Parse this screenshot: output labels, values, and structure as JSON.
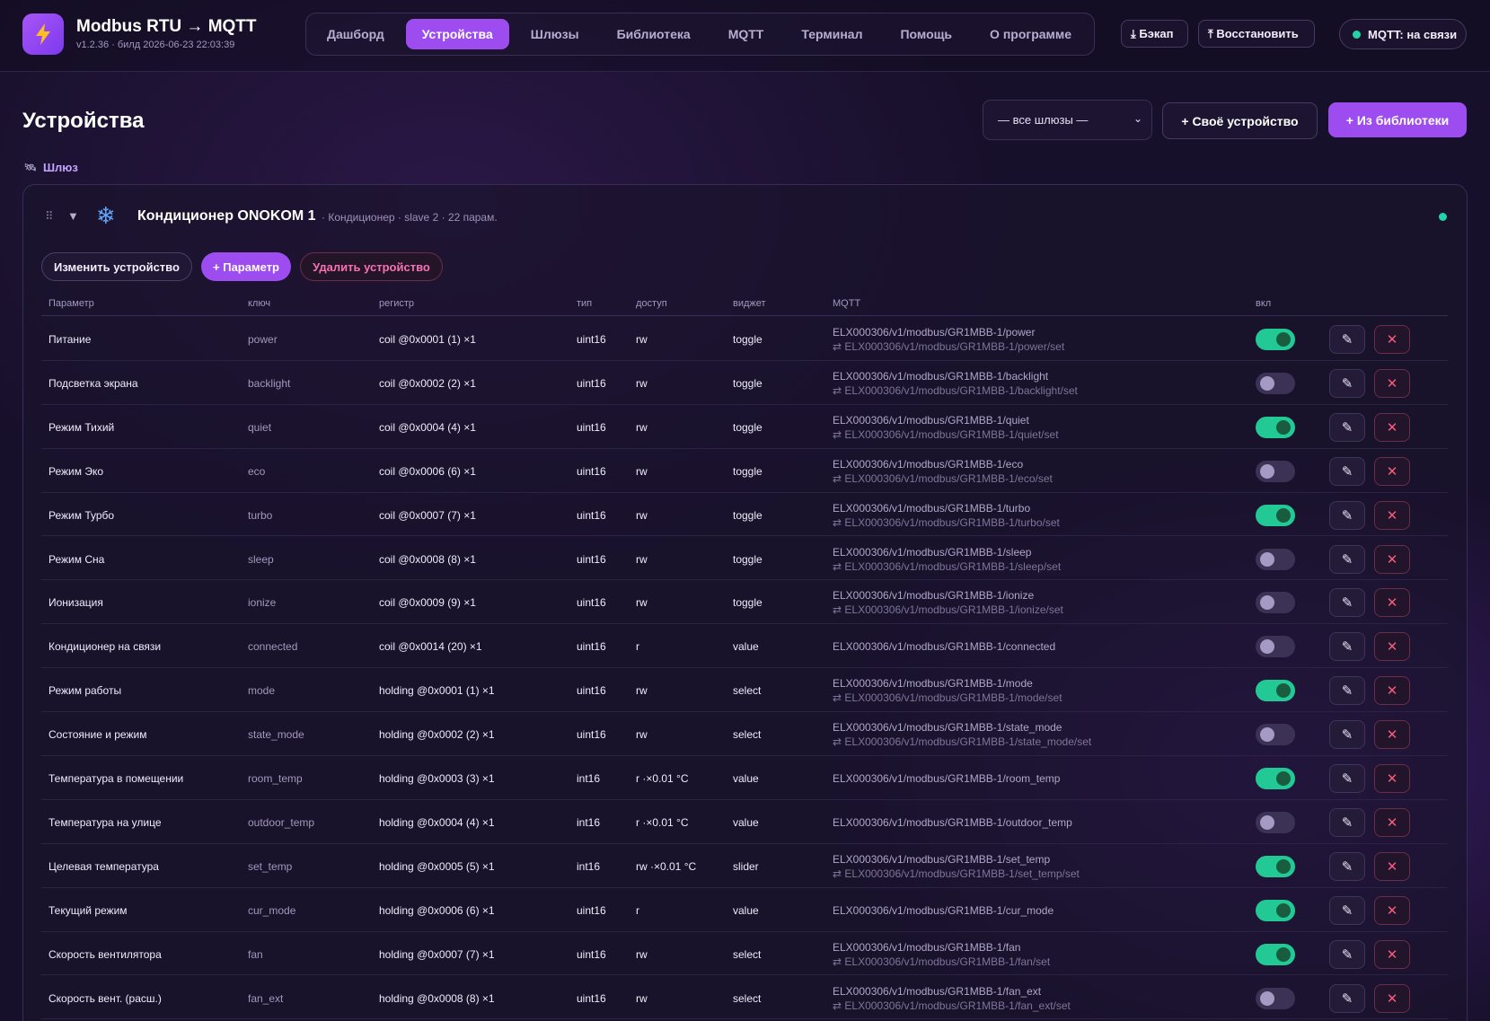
{
  "app": {
    "title": "Modbus RTU → MQTT",
    "subtitle": "v1.2.36 · билд 2026-06-23 22:03:39"
  },
  "nav": {
    "tabs": [
      {
        "label": "Дашборд",
        "active": false
      },
      {
        "label": "Устройства",
        "active": true
      },
      {
        "label": "Шлюзы",
        "active": false
      },
      {
        "label": "Библиотека",
        "active": false
      },
      {
        "label": "MQTT",
        "active": false
      },
      {
        "label": "Терминал",
        "active": false
      },
      {
        "label": "Помощь",
        "active": false
      },
      {
        "label": "О программе",
        "active": false
      }
    ]
  },
  "header_actions": {
    "backup_label": "⤓ Бэкап",
    "restore_label": "⤒ Восстановить",
    "mqtt_status": "MQTT: на связи"
  },
  "page": {
    "title": "Устройства",
    "gateway_filter": "— все шлюзы —",
    "add_custom_label": "+ Своё устройство",
    "add_from_library_label": "+ Из библиотеки",
    "gateway_group_label": "Шлюз"
  },
  "device": {
    "name": "Кондиционер ONOKOM 1",
    "meta": "· Кондиционер · slave 2 · 22 парам.",
    "online": true,
    "edit_label": "Изменить устройство",
    "add_param_label": "+ Параметр",
    "delete_label": "Удалить устройство"
  },
  "table": {
    "headers": {
      "name": "Параметр",
      "key": "ключ",
      "register": "регистр",
      "type": "тип",
      "access": "доступ",
      "widget": "виджет",
      "mqtt": "MQTT",
      "enabled": "вкл"
    },
    "rows": [
      {
        "name": "Питание",
        "key": "power",
        "register": "coil @0x0001 (1) ×1",
        "type": "uint16",
        "access": "rw",
        "widget": "toggle",
        "topic": "ELX000306/v1/modbus/GR1MBB-1/power",
        "set_topic": "⇄ ELX000306/v1/modbus/GR1MBB-1/power/set",
        "enabled": true
      },
      {
        "name": "Подсветка экрана",
        "key": "backlight",
        "register": "coil @0x0002 (2) ×1",
        "type": "uint16",
        "access": "rw",
        "widget": "toggle",
        "topic": "ELX000306/v1/modbus/GR1MBB-1/backlight",
        "set_topic": "⇄ ELX000306/v1/modbus/GR1MBB-1/backlight/set",
        "enabled": false
      },
      {
        "name": "Режим Тихий",
        "key": "quiet",
        "register": "coil @0x0004 (4) ×1",
        "type": "uint16",
        "access": "rw",
        "widget": "toggle",
        "topic": "ELX000306/v1/modbus/GR1MBB-1/quiet",
        "set_topic": "⇄ ELX000306/v1/modbus/GR1MBB-1/quiet/set",
        "enabled": true
      },
      {
        "name": "Режим Эко",
        "key": "eco",
        "register": "coil @0x0006 (6) ×1",
        "type": "uint16",
        "access": "rw",
        "widget": "toggle",
        "topic": "ELX000306/v1/modbus/GR1MBB-1/eco",
        "set_topic": "⇄ ELX000306/v1/modbus/GR1MBB-1/eco/set",
        "enabled": false
      },
      {
        "name": "Режим Турбо",
        "key": "turbo",
        "register": "coil @0x0007 (7) ×1",
        "type": "uint16",
        "access": "rw",
        "widget": "toggle",
        "topic": "ELX000306/v1/modbus/GR1MBB-1/turbo",
        "set_topic": "⇄ ELX000306/v1/modbus/GR1MBB-1/turbo/set",
        "enabled": true
      },
      {
        "name": "Режим Сна",
        "key": "sleep",
        "register": "coil @0x0008 (8) ×1",
        "type": "uint16",
        "access": "rw",
        "widget": "toggle",
        "topic": "ELX000306/v1/modbus/GR1MBB-1/sleep",
        "set_topic": "⇄ ELX000306/v1/modbus/GR1MBB-1/sleep/set",
        "enabled": false
      },
      {
        "name": "Ионизация",
        "key": "ionize",
        "register": "coil @0x0009 (9) ×1",
        "type": "uint16",
        "access": "rw",
        "widget": "toggle",
        "topic": "ELX000306/v1/modbus/GR1MBB-1/ionize",
        "set_topic": "⇄ ELX000306/v1/modbus/GR1MBB-1/ionize/set",
        "enabled": false
      },
      {
        "name": "Кондиционер на связи",
        "key": "connected",
        "register": "coil @0x0014 (20) ×1",
        "type": "uint16",
        "access": "r",
        "widget": "value",
        "topic": "ELX000306/v1/modbus/GR1MBB-1/connected",
        "set_topic": "",
        "enabled": false
      },
      {
        "name": "Режим работы",
        "key": "mode",
        "register": "holding @0x0001 (1) ×1",
        "type": "uint16",
        "access": "rw",
        "widget": "select",
        "topic": "ELX000306/v1/modbus/GR1MBB-1/mode",
        "set_topic": "⇄ ELX000306/v1/modbus/GR1MBB-1/mode/set",
        "enabled": true
      },
      {
        "name": "Состояние и режим",
        "key": "state_mode",
        "register": "holding @0x0002 (2) ×1",
        "type": "uint16",
        "access": "rw",
        "widget": "select",
        "topic": "ELX000306/v1/modbus/GR1MBB-1/state_mode",
        "set_topic": "⇄ ELX000306/v1/modbus/GR1MBB-1/state_mode/set",
        "enabled": false
      },
      {
        "name": "Температура в помещении",
        "key": "room_temp",
        "register": "holding @0x0003 (3) ×1",
        "type": "int16",
        "access": "r ·×0.01 °C",
        "widget": "value",
        "topic": "ELX000306/v1/modbus/GR1MBB-1/room_temp",
        "set_topic": "",
        "enabled": true
      },
      {
        "name": "Температура на улице",
        "key": "outdoor_temp",
        "register": "holding @0x0004 (4) ×1",
        "type": "int16",
        "access": "r ·×0.01 °C",
        "widget": "value",
        "topic": "ELX000306/v1/modbus/GR1MBB-1/outdoor_temp",
        "set_topic": "",
        "enabled": false
      },
      {
        "name": "Целевая температура",
        "key": "set_temp",
        "register": "holding @0x0005 (5) ×1",
        "type": "int16",
        "access": "rw ·×0.01 °C",
        "widget": "slider",
        "topic": "ELX000306/v1/modbus/GR1MBB-1/set_temp",
        "set_topic": "⇄ ELX000306/v1/modbus/GR1MBB-1/set_temp/set",
        "enabled": true
      },
      {
        "name": "Текущий режим",
        "key": "cur_mode",
        "register": "holding @0x0006 (6) ×1",
        "type": "uint16",
        "access": "r",
        "widget": "value",
        "topic": "ELX000306/v1/modbus/GR1MBB-1/cur_mode",
        "set_topic": "",
        "enabled": true
      },
      {
        "name": "Скорость вентилятора",
        "key": "fan",
        "register": "holding @0x0007 (7) ×1",
        "type": "uint16",
        "access": "rw",
        "widget": "select",
        "topic": "ELX000306/v1/modbus/GR1MBB-1/fan",
        "set_topic": "⇄ ELX000306/v1/modbus/GR1MBB-1/fan/set",
        "enabled": true
      },
      {
        "name": "Скорость вент. (расш.)",
        "key": "fan_ext",
        "register": "holding @0x0008 (8) ×1",
        "type": "uint16",
        "access": "rw",
        "widget": "select",
        "topic": "ELX000306/v1/modbus/GR1MBB-1/fan_ext",
        "set_topic": "⇄ ELX000306/v1/modbus/GR1MBB-1/fan_ext/set",
        "enabled": false
      }
    ]
  },
  "colors": {
    "accent": "#9d4cf0",
    "online": "#22d3a5",
    "toggle_on": "#22c994",
    "danger": "#f25d7a"
  }
}
